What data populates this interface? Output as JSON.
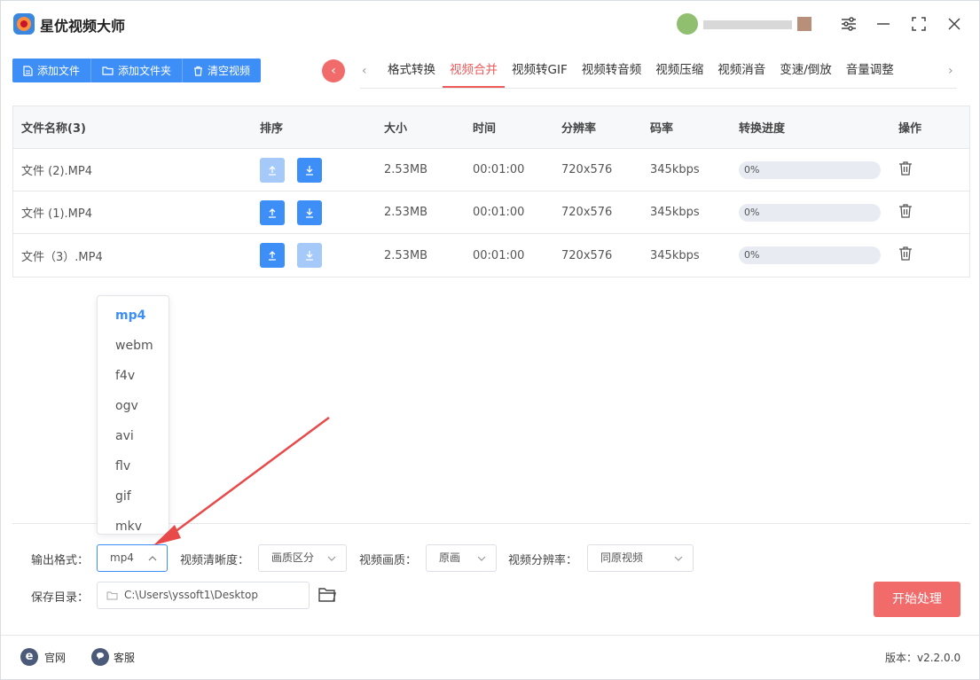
{
  "app": {
    "title": "星优视频大师",
    "version_label": "版本：v2.2.0.0"
  },
  "toolbar": {
    "add_file": "添加文件",
    "add_folder": "添加文件夹",
    "clear": "清空视频"
  },
  "tabs": [
    "格式转换",
    "视频合并",
    "视频转GIF",
    "视频转音频",
    "视频压缩",
    "视频消音",
    "变速/倒放",
    "音量调整"
  ],
  "active_tab": "视频合并",
  "table": {
    "headers": [
      "文件名称(3)",
      "排序",
      "大小",
      "时间",
      "分辨率",
      "码率",
      "转换进度",
      "操作"
    ],
    "rows": [
      {
        "name": "文件 (2).MP4",
        "size": "2.53MB",
        "time": "00:01:00",
        "res": "720x576",
        "bitrate": "345kbps",
        "progress": "0%"
      },
      {
        "name": "文件 (1).MP4",
        "size": "2.53MB",
        "time": "00:01:00",
        "res": "720x576",
        "bitrate": "345kbps",
        "progress": "0%"
      },
      {
        "name": "文件（3）.MP4",
        "size": "2.53MB",
        "time": "00:01:00",
        "res": "720x576",
        "bitrate": "345kbps",
        "progress": "0%"
      }
    ]
  },
  "format_options": [
    "mp4",
    "webm",
    "f4v",
    "ogv",
    "avi",
    "flv",
    "gif",
    "mkv"
  ],
  "settings": {
    "format_label": "输出格式：",
    "format_value": "mp4",
    "clarity_label": "视频清晰度：",
    "clarity_value": "画质区分",
    "quality_label": "视频画质：",
    "quality_value": "原画",
    "resolution_label": "视频分辨率：",
    "resolution_value": "同原视频",
    "dir_label": "保存目录：",
    "dir_value": "C:\\Users\\yssoft1\\Desktop",
    "start": "开始处理"
  },
  "footer": {
    "website": "官网",
    "support": "客服"
  },
  "colors": {
    "primary": "#3e8ef7",
    "accent": "#ef5b5b",
    "arrow": "#e84a4a"
  }
}
